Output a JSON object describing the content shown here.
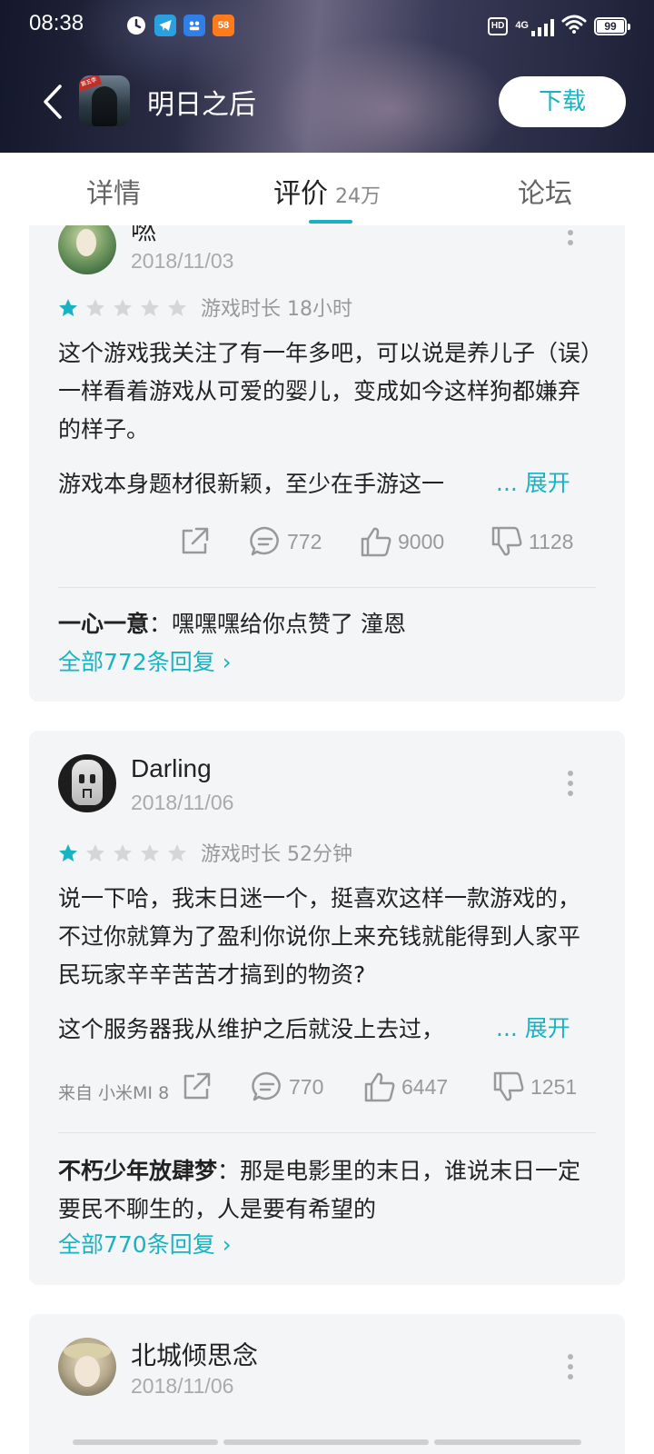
{
  "status": {
    "time": "08:38",
    "notif_icons": [
      "clock-icon",
      "telegram-icon",
      "app-icon",
      "58-app-icon"
    ],
    "notif_58_label": "58",
    "hd": "HD",
    "network": "4G",
    "battery": "99",
    "battery_level": 0.99
  },
  "app": {
    "title": "明日之后",
    "download_label": "下载",
    "icon_ribbon": "第五季"
  },
  "tabs": {
    "detail": "详情",
    "review": "评价",
    "review_count": "24万",
    "forum": "论坛"
  },
  "colors": {
    "accent": "#17b3c2",
    "star_on": "#17b3c2",
    "star_off": "#d6d6d9"
  },
  "reviews": [
    {
      "username": "嘫",
      "date": "2018/11/03",
      "rating": 1,
      "playtime": "游戏时长 18小时",
      "body": "这个游戏我关注了有一年多吧，可以说是养儿子（误）一样看着游戏从可爱的婴儿，变成如今这样狗都嫌弃的样子。",
      "teaser": "游戏本身题材很新颖，至少在手游这一",
      "expand": "... 展开",
      "device": "",
      "comments": "772",
      "likes": "9000",
      "dislikes": "1128",
      "reply_user": "一心一意",
      "reply_text": "：嘿嘿嘿给你点赞了 潼恩",
      "reply_link": "全部772条回复 ›"
    },
    {
      "username": "Darling",
      "date": "2018/11/06",
      "rating": 1,
      "playtime": "游戏时长 52分钟",
      "body": "说一下哈，我末日迷一个，挺喜欢这样一款游戏的，不过你就算为了盈利你说你上来充钱就能得到人家平民玩家辛辛苦苦才搞到的物资?",
      "teaser": "这个服务器我从维护之后就没上去过，",
      "expand": "... 展开",
      "device": "来自 小米MI 8",
      "comments": "770",
      "likes": "6447",
      "dislikes": "1251",
      "reply_user": "不朽少年放肆梦",
      "reply_text": "：那是电影里的末日，谁说末日一定要民不聊生的，人是要有希望的",
      "reply_link": "全部770条回复 ›"
    },
    {
      "username": "北城倾思念",
      "date": "2018/11/06"
    }
  ]
}
